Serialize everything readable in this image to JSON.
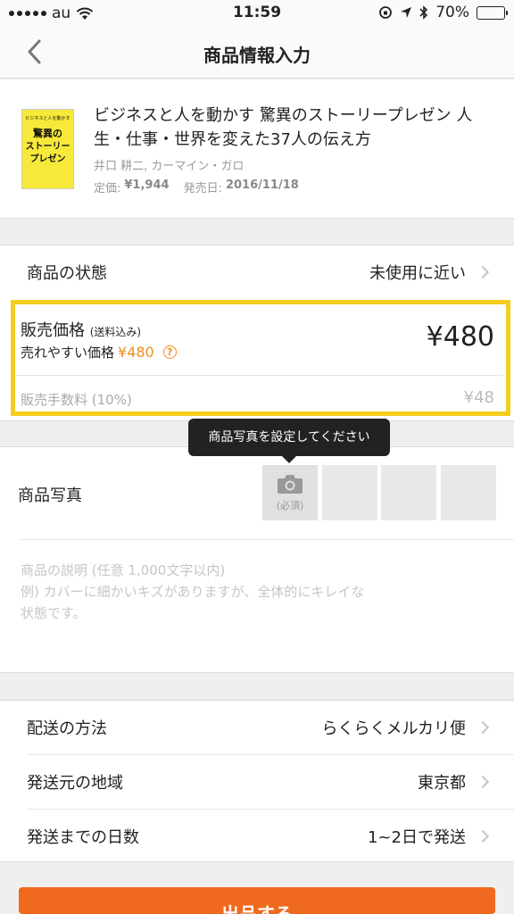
{
  "status_bar": {
    "carrier": "au",
    "time": "11:59",
    "battery": "70%",
    "battery_level": 0.7
  },
  "nav": {
    "title": "商品情報入力"
  },
  "book": {
    "cover_lines": [
      "ビジネスと人を動かす",
      "驚異の",
      "ストーリー",
      "プレゼン"
    ],
    "title": "ビジネスと人を動かす 驚異のストーリープレゼン 人生・仕事・世界を変えた37人の伝え方",
    "author": "井口 耕二, カーマイン・ガロ",
    "list_price_label": "定価:",
    "list_price": "¥1,944",
    "release_label": "発売日:",
    "release_date": "2016/11/18"
  },
  "condition": {
    "label": "商品の状態",
    "value": "未使用に近い"
  },
  "price": {
    "label": "販売価格",
    "label_note": "(送料込み)",
    "easy_label": "売れやすい価格",
    "easy_value": "¥480",
    "help": "?",
    "value": "¥480",
    "fee_label": "販売手数料 (10%)",
    "fee_value": "¥48"
  },
  "photos": {
    "tooltip": "商品写真を設定してください",
    "label": "商品写真",
    "required": "(必須)"
  },
  "description": {
    "placeholder_line1": "商品の説明 (任意 1,000文字以内)",
    "placeholder_line2": "例) カバーに細かいキズがありますが、全体的にキレイな",
    "placeholder_line3": "状態です。"
  },
  "shipping": [
    {
      "label": "配送の方法",
      "value": "らくらくメルカリ便"
    },
    {
      "label": "発送元の地域",
      "value": "東京都"
    },
    {
      "label": "発送までの日数",
      "value": "1~2日で発送"
    }
  ],
  "submit_label": "出品する",
  "colors": {
    "accent": "#ef6a1f",
    "highlight": "#f5cd1e",
    "orange_text": "#f08c1e"
  }
}
